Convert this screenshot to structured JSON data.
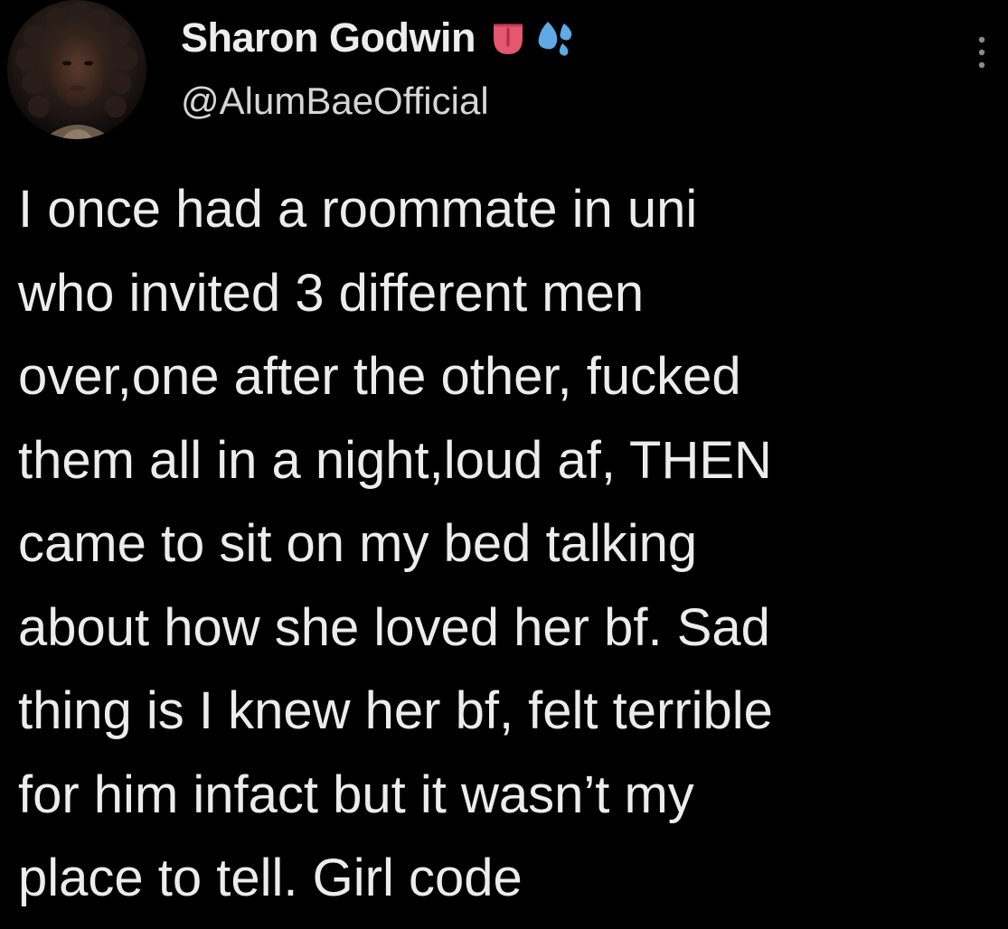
{
  "author": {
    "display_name": "Sharon Godwin",
    "handle": "@AlumBaeOfficial",
    "name_emojis": [
      "tongue-emoji",
      "sweat-droplets-emoji"
    ]
  },
  "tweet": {
    "lines": [
      "I once had a roommate in uni",
      "who invited 3 different men",
      "over,one after the other, fucked",
      "them all in a night,loud af, THEN",
      "came to sit on my bed talking",
      "about how she loved her bf. Sad",
      "thing is I knew her bf, felt terrible",
      "for him infact but it wasn’t my",
      "place to tell. Girl code"
    ]
  },
  "icons": {
    "more": "more-options-icon"
  },
  "colors": {
    "background": "#000000",
    "text": "#ececec",
    "tongue": "#e5566f",
    "droplets": "#5ea9e6"
  }
}
